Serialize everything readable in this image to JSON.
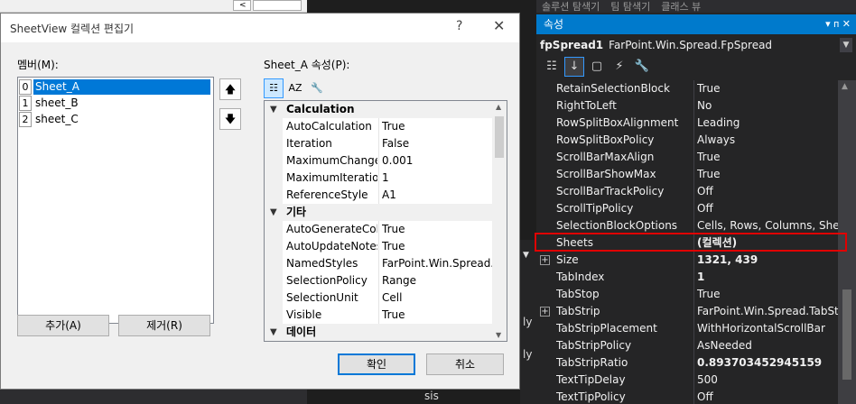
{
  "dialog": {
    "title": "SheetView 컬렉션 편집기",
    "help_icon": "?",
    "close_icon": "✕",
    "members_label": "멤버(M):",
    "members": [
      {
        "index": "0",
        "name": "Sheet_A"
      },
      {
        "index": "1",
        "name": "sheet_B"
      },
      {
        "index": "2",
        "name": "sheet_C"
      }
    ],
    "move_up_icon": "arrow-up-icon",
    "move_down_icon": "arrow-down-icon",
    "properties_label": "Sheet_A 속성(P):",
    "categories": [
      {
        "name": "Calculation",
        "props": [
          {
            "name": "AutoCalculation",
            "value": "True"
          },
          {
            "name": "Iteration",
            "value": "False"
          },
          {
            "name": "MaximumChange",
            "value": "0.001"
          },
          {
            "name": "MaximumIterations",
            "value": "1"
          },
          {
            "name": "ReferenceStyle",
            "value": "A1"
          }
        ]
      },
      {
        "name": "기타",
        "props": [
          {
            "name": "AutoGenerateColumns",
            "value": "True"
          },
          {
            "name": "AutoUpdateNotes",
            "value": "True"
          },
          {
            "name": "NamedStyles",
            "value": "FarPoint.Win.Spread.NamedStyleCollection"
          },
          {
            "name": "SelectionPolicy",
            "value": "Range"
          },
          {
            "name": "SelectionUnit",
            "value": "Cell"
          },
          {
            "name": "Visible",
            "value": "True"
          }
        ]
      },
      {
        "name": "데이터",
        "props": []
      }
    ],
    "add_button": "추가(A)",
    "remove_button": "제거(R)",
    "ok_button": "확인",
    "cancel_button": "취소"
  },
  "properties_panel": {
    "tabs": [
      "솔루션 탐색기",
      "팀 탐색기",
      "클래스 뷰"
    ],
    "title": "속성",
    "title_buttons": "▾ ᴨ ✕",
    "object_name": "fpSpread1",
    "object_type": "FarPoint.Win.Spread.FpSpread",
    "rows": [
      {
        "name": "RetainSelectionBlock",
        "value": "True",
        "bold": false,
        "expandable": false
      },
      {
        "name": "RightToLeft",
        "value": "No",
        "bold": false,
        "expandable": false
      },
      {
        "name": "RowSplitBoxAlignment",
        "value": "Leading",
        "bold": false,
        "expandable": false
      },
      {
        "name": "RowSplitBoxPolicy",
        "value": "Always",
        "bold": false,
        "expandable": false
      },
      {
        "name": "ScrollBarMaxAlign",
        "value": "True",
        "bold": false,
        "expandable": false
      },
      {
        "name": "ScrollBarShowMax",
        "value": "True",
        "bold": false,
        "expandable": false
      },
      {
        "name": "ScrollBarTrackPolicy",
        "value": "Off",
        "bold": false,
        "expandable": false
      },
      {
        "name": "ScrollTipPolicy",
        "value": "Off",
        "bold": false,
        "expandable": false
      },
      {
        "name": "SelectionBlockOptions",
        "value": "Cells, Rows, Columns, Sheet",
        "bold": false,
        "expandable": false
      },
      {
        "name": "Sheets",
        "value": "(컬렉션)",
        "bold": true,
        "expandable": false
      },
      {
        "name": "Size",
        "value": "1321, 439",
        "bold": true,
        "expandable": true
      },
      {
        "name": "TabIndex",
        "value": "1",
        "bold": true,
        "expandable": false
      },
      {
        "name": "TabStop",
        "value": "True",
        "bold": false,
        "expandable": false
      },
      {
        "name": "TabStrip",
        "value": "FarPoint.Win.Spread.TabStrip",
        "bold": false,
        "expandable": true
      },
      {
        "name": "TabStripPlacement",
        "value": "WithHorizontalScrollBar",
        "bold": false,
        "expandable": false
      },
      {
        "name": "TabStripPolicy",
        "value": "AsNeeded",
        "bold": false,
        "expandable": false
      },
      {
        "name": "TabStripRatio",
        "value": "0.893703452945159",
        "bold": true,
        "expandable": false
      },
      {
        "name": "TextTipDelay",
        "value": "500",
        "bold": false,
        "expandable": false
      },
      {
        "name": "TextTipPolicy",
        "value": "Off",
        "bold": false,
        "expandable": false
      }
    ]
  },
  "background": {
    "bottom_text": "sis",
    "side_text_1": "ly",
    "side_text_2": "ly"
  }
}
